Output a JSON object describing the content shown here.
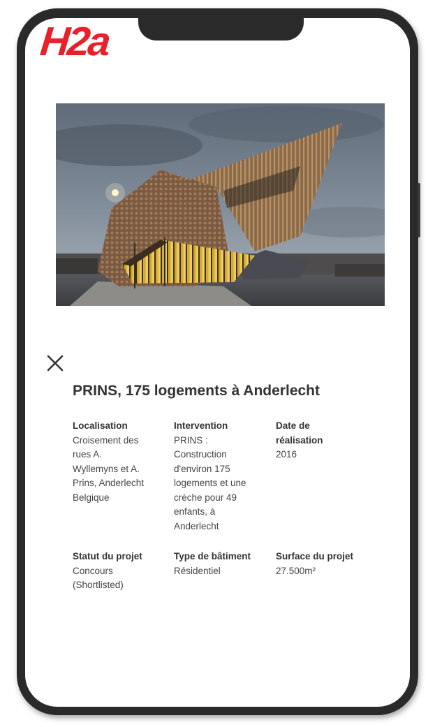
{
  "brand": {
    "logo_text": "H2a",
    "accent_color": "#e8202a"
  },
  "project": {
    "title": "PRINS, 175 logements à Anderlecht",
    "close_icon": "close-icon",
    "details": [
      {
        "label": "Localisation",
        "value": "Croisement des\nrues A.\nWyllemyns et A.\nPrins, Anderlecht\nBelgique"
      },
      {
        "label": "Intervention",
        "value": "PRINS :\nConstruction\nd'environ 175\nlogements et une\ncrèche pour 49\nenfants, à\nAnderlecht"
      },
      {
        "label": "Date de\nréalisation",
        "value": "2016"
      },
      {
        "label": "Statut du projet",
        "value": "Concours\n(Shortlisted)"
      },
      {
        "label": "Type de bâtiment",
        "value": "Résidentiel"
      },
      {
        "label": "Surface du projet",
        "value": "27.500m²"
      }
    ]
  }
}
